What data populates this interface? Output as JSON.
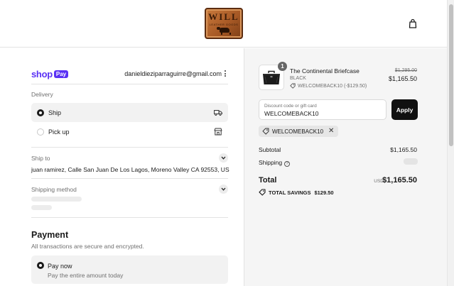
{
  "header": {
    "logo_text": "WILL",
    "logo_subtext": "LEATHER GOODS",
    "cart_icon": "shopping-bag-icon"
  },
  "account": {
    "shop_label": "shop",
    "pay_label": "Pay",
    "email": "danieldieziparraguirre@gmail.com"
  },
  "delivery": {
    "label": "Delivery",
    "options": [
      {
        "label": "Ship",
        "selected": true,
        "icon": "truck-icon"
      },
      {
        "label": "Pick up",
        "selected": false,
        "icon": "store-icon"
      }
    ]
  },
  "ship_to": {
    "label": "Ship to",
    "address": "juan ramirez, Calle San Juan De Los Lagos, Moreno Valley CA 92553, US"
  },
  "shipping_method": {
    "label": "Shipping method"
  },
  "payment": {
    "title": "Payment",
    "subtitle": "All transactions are secure and encrypted.",
    "option_title": "Pay now",
    "option_subtitle": "Pay the entire amount today"
  },
  "cart": {
    "quantity": "1",
    "product_name": "The Continental Briefcase",
    "variant": "BLACK",
    "discount_line": "WELCOMEBACK10 (-$129.50)",
    "original_price": "$1,295.00",
    "price": "$1,165.50"
  },
  "discount": {
    "placeholder": "Discount code or gift card",
    "value": "WELCOMEBACK10",
    "apply_label": "Apply",
    "chip_label": "WELCOMEBACK10"
  },
  "summary": {
    "subtotal_label": "Subtotal",
    "subtotal_value": "$1,165.50",
    "shipping_label": "Shipping",
    "total_label": "Total",
    "currency": "USD",
    "total_value": "$1,165.50",
    "savings_label": "TOTAL SAVINGS",
    "savings_value": "$129.50"
  },
  "colors": {
    "shop_pay_purple": "#5a31f4",
    "apply_button": "#111111",
    "summary_background": "#f5f5f5"
  }
}
